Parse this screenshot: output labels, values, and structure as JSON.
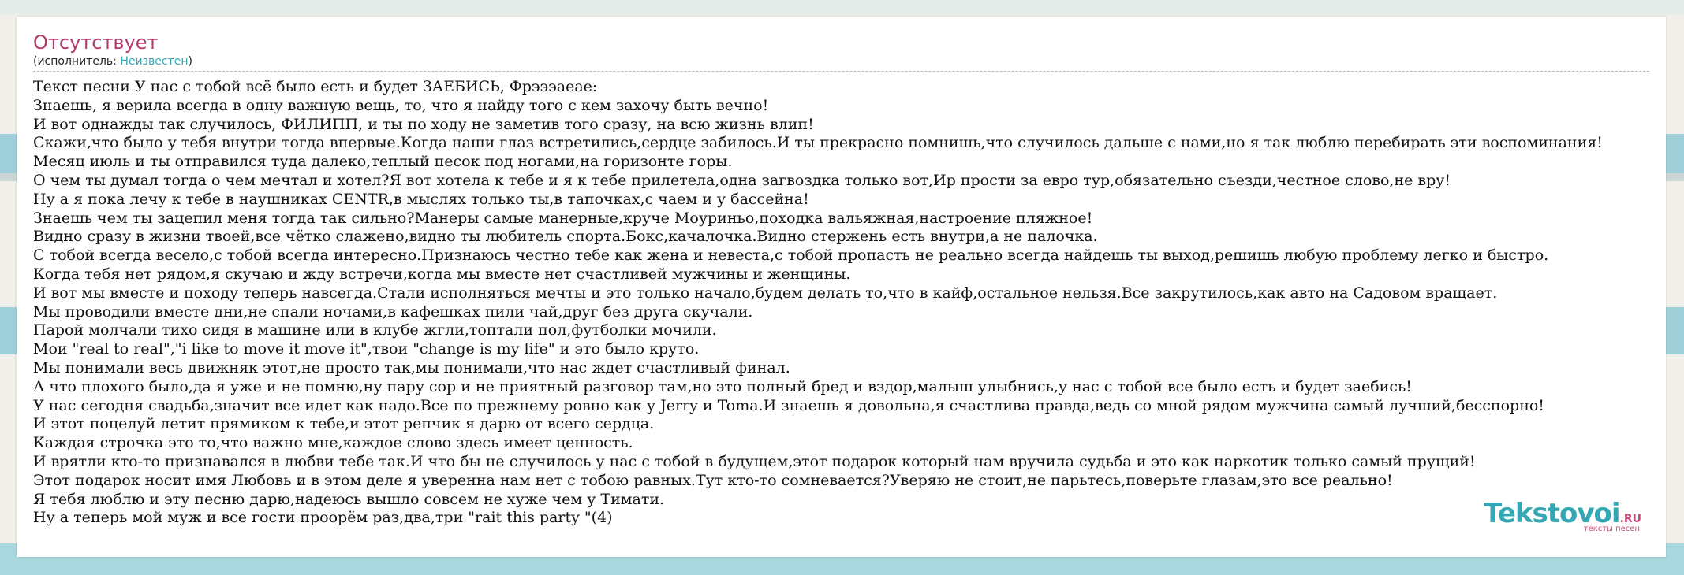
{
  "song": {
    "title": "Отсутствует",
    "artist_prefix": "(исполнитель: ",
    "artist_name": "Неизвестен",
    "artist_suffix": ")"
  },
  "lyrics": [
    "Текст песни У нас с тобой всё было есть и будет ЗАЕБИСЬ, Фрэээаеае:",
    "Знаешь, я верила всегда в одну важную вещь, то, что я найду того с кем захочу быть вечно!",
    "И вот однажды так случилось, ФИЛИПП, и ты по ходу не заметив того сразу, на всю жизнь влип!",
    "Скажи,что было у тебя внутри тогда впервые.Когда наши глаз встретились,сердце забилось.И ты прекрасно помнишь,что случилось дальше с нами,но я так люблю перебирать эти воспоминания!",
    "Месяц июль и ты отправился туда далеко,теплый песок под ногами,на горизонте горы.",
    "О чем ты думал тогда о чем мечтал и хотел?Я вот хотела к тебе и я к тебе прилетела,одна загвоздка только вот,Ир прости за евро тур,обязательно съезди,честное слово,не вру!",
    "Ну а я пока лечу к тебе в наушниках CENTR,в мыслях только ты,в тапочках,с чаем и у бассейна!",
    "Знаешь чем ты зацепил меня тогда так сильно?Манеры самые манерные,круче Моуриньо,походка вальяжная,настроение пляжное!",
    "Видно сразу в жизни твоей,все чётко слажено,видно ты любитель спорта.Бокс,качалочка.Видно стержень есть внутри,а не палочка.",
    "С тобой всегда весело,с тобой всегда интересно.Признаюсь честно тебе как жена и невеста,с тобой пропасть не реально всегда найдешь ты выход,решишь любую проблему легко и быстро.",
    "Когда тебя нет рядом,я скучаю и жду встречи,когда мы вместе нет счастливей мужчины и женщины.",
    "И вот мы вместе и походу теперь навсегда.Стали исполняться мечты и это только начало,будем делать то,что в кайф,остальное нельзя.Все закрутилось,как авто на Садовом вращает.",
    "Мы проводили вместе дни,не спали ночами,в кафешках пили чай,друг без друга скучали.",
    "Парой молчали тихо сидя в машине или в клубе жгли,топтали пол,футболки мочили.",
    "Мои \"real to real\",\"i like to move it move it\",твои \"change is my life\" и это было круто.",
    "Мы понимали весь движняк этот,не просто так,мы понимали,что нас ждет счастливый финал.",
    "А что плохого было,да я уже и не помню,ну пару сор и не приятный разговор там,но это полный бред и вздор,малыш улыбнись,у нас с тобой все было есть и будет заебись!",
    "У нас сегодня свадьба,значит все идет как надо.Все по прежнему ровно как у Jerry и Toma.И знаешь я довольна,я счастлива правда,ведь со мной рядом мужчина самый лучший,бесспорно!",
    "И этот поцелуй летит прямиком к тебе,и этот репчик я дарю от всего сердца.",
    "Каждая строчка это то,что важно мне,каждое слово здесь имеет ценность.",
    "И врятли кто-то признавался в любви тебе так.И что бы не случилось у нас с тобой в будущем,этот подарок который нам вручила судьба и это как наркотик только самый прущий!",
    "Этот подарок носит имя Любовь и в этом деле я уверенна нам нет с тобою равных.Тут кто-то сомневается?Уверяю не стоит,не парьтесь,поверьте глазам,это все реально!",
    "Я тебя люблю и эту песню дарю,надеюсь вышло совсем не хуже чем у Тимати.",
    "Ну а теперь мой муж и все гости проорём раз,два,три \"rait this party \"(4)"
  ],
  "logo": {
    "main": "Tekstovoi",
    "tld": ".RU",
    "subtitle": "тексты песен"
  },
  "colors": {
    "title": "#b33a6c",
    "link": "#3aa4b8",
    "logo": "#33a8b4",
    "logo_accent": "#c9497c"
  }
}
